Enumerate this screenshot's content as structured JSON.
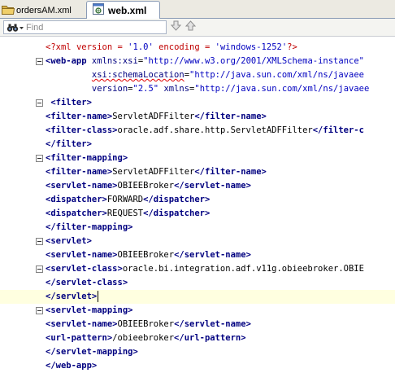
{
  "tabs": [
    {
      "label": "ordersAM.xml",
      "icon": "folder-icon",
      "active": false
    },
    {
      "label": "web.xml",
      "icon": "web-xml-icon",
      "active": true
    }
  ],
  "find": {
    "placeholder": "Find",
    "value": ""
  },
  "editor": {
    "lines": {
      "l1": {
        "open": "<?xml ",
        "a1": "version",
        "eq1": " = ",
        "v1": "'1.0'",
        "sp": " ",
        "a2": "encoding",
        "eq2": " = ",
        "v2": "'windows-1252'",
        "close": "?>"
      },
      "l2": {
        "lt": "<",
        "tag": "web-app",
        "sp": " ",
        "attr": "xmlns:xsi",
        "eq": "=",
        "val": "\"http://www.w3.org/2001/XMLSchema-instance\""
      },
      "l3": {
        "indent": "         ",
        "attr": "xsi:schemaLocation",
        "eq": "=",
        "val": "\"http://java.sun.com/xml/ns/javaee"
      },
      "l4": {
        "indent": "         ",
        "a1": "version",
        "eq1": "=",
        "v1": "\"2.5\"",
        "sp": " ",
        "a2": "xmlns",
        "eq2": "=",
        "v2": "\"http://java.sun.com/xml/ns/javaee"
      },
      "l5": {
        "open": " <filter>"
      },
      "l6": {
        "open": "<filter-name>",
        "text": "ServletADFFilter",
        "close": "</filter-name>"
      },
      "l7": {
        "open": "<filter-class>",
        "text": "oracle.adf.share.http.ServletADFFilter",
        "close": "</filter-c"
      },
      "l8": {
        "close": "</filter>"
      },
      "l9": {
        "open": "<filter-mapping>"
      },
      "l10": {
        "open": "<filter-name>",
        "text": "ServletADFFilter",
        "close": "</filter-name>"
      },
      "l11": {
        "open": "<servlet-name>",
        "text": "OBIEEBroker",
        "close": "</servlet-name>"
      },
      "l12": {
        "open": "<dispatcher>",
        "text": "FORWARD",
        "close": "</dispatcher>"
      },
      "l13": {
        "open": "<dispatcher>",
        "text": "REQUEST",
        "close": "</dispatcher>"
      },
      "l14": {
        "close": "</filter-mapping>"
      },
      "l15": {
        "open": "<servlet>"
      },
      "l16": {
        "open": "<servlet-name>",
        "text": "OBIEEBroker",
        "close": "</servlet-name>"
      },
      "l17": {
        "open": "<servlet-class>",
        "text": "oracle.bi.integration.adf.v11g.obieebroker.OBIE"
      },
      "l18": {
        "close": "</servlet-class>"
      },
      "l19": {
        "close": "</servlet>"
      },
      "l20": {
        "open": "<servlet-mapping>"
      },
      "l21": {
        "open": "<servlet-name>",
        "text": "OBIEEBroker",
        "close": "</servlet-name>"
      },
      "l22": {
        "open": "<url-pattern>",
        "text": "/obieebroker",
        "close": "</url-pattern>"
      },
      "l23": {
        "close": "</servlet-mapping>"
      },
      "l24": {
        "close": "</web-app>"
      }
    }
  }
}
